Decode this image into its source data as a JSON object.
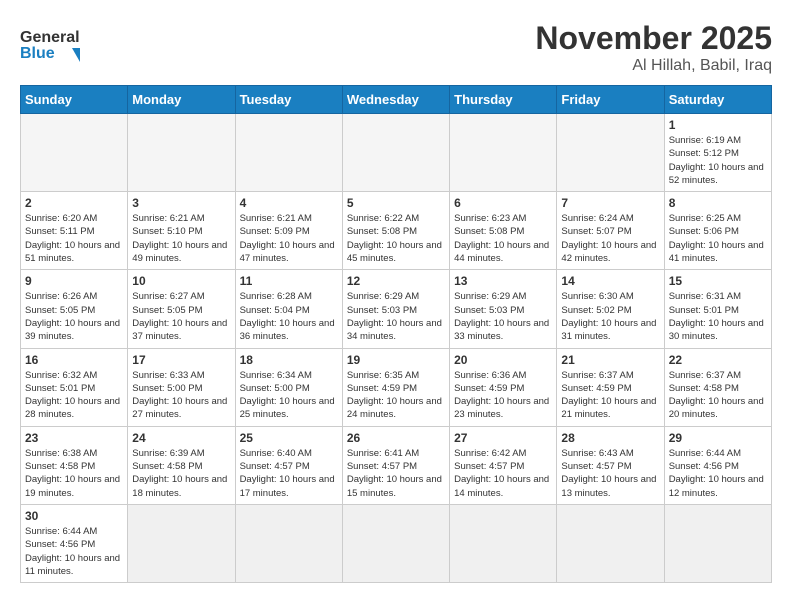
{
  "header": {
    "logo_general": "General",
    "logo_blue": "Blue",
    "month_title": "November 2025",
    "location": "Al Hillah, Babil, Iraq"
  },
  "calendar": {
    "days_of_week": [
      "Sunday",
      "Monday",
      "Tuesday",
      "Wednesday",
      "Thursday",
      "Friday",
      "Saturday"
    ],
    "weeks": [
      [
        {
          "day": "",
          "info": ""
        },
        {
          "day": "",
          "info": ""
        },
        {
          "day": "",
          "info": ""
        },
        {
          "day": "",
          "info": ""
        },
        {
          "day": "",
          "info": ""
        },
        {
          "day": "",
          "info": ""
        },
        {
          "day": "1",
          "info": "Sunrise: 6:19 AM\nSunset: 5:12 PM\nDaylight: 10 hours and 52 minutes."
        }
      ],
      [
        {
          "day": "2",
          "info": "Sunrise: 6:20 AM\nSunset: 5:11 PM\nDaylight: 10 hours and 51 minutes."
        },
        {
          "day": "3",
          "info": "Sunrise: 6:21 AM\nSunset: 5:10 PM\nDaylight: 10 hours and 49 minutes."
        },
        {
          "day": "4",
          "info": "Sunrise: 6:21 AM\nSunset: 5:09 PM\nDaylight: 10 hours and 47 minutes."
        },
        {
          "day": "5",
          "info": "Sunrise: 6:22 AM\nSunset: 5:08 PM\nDaylight: 10 hours and 45 minutes."
        },
        {
          "day": "6",
          "info": "Sunrise: 6:23 AM\nSunset: 5:08 PM\nDaylight: 10 hours and 44 minutes."
        },
        {
          "day": "7",
          "info": "Sunrise: 6:24 AM\nSunset: 5:07 PM\nDaylight: 10 hours and 42 minutes."
        },
        {
          "day": "8",
          "info": "Sunrise: 6:25 AM\nSunset: 5:06 PM\nDaylight: 10 hours and 41 minutes."
        }
      ],
      [
        {
          "day": "9",
          "info": "Sunrise: 6:26 AM\nSunset: 5:05 PM\nDaylight: 10 hours and 39 minutes."
        },
        {
          "day": "10",
          "info": "Sunrise: 6:27 AM\nSunset: 5:05 PM\nDaylight: 10 hours and 37 minutes."
        },
        {
          "day": "11",
          "info": "Sunrise: 6:28 AM\nSunset: 5:04 PM\nDaylight: 10 hours and 36 minutes."
        },
        {
          "day": "12",
          "info": "Sunrise: 6:29 AM\nSunset: 5:03 PM\nDaylight: 10 hours and 34 minutes."
        },
        {
          "day": "13",
          "info": "Sunrise: 6:29 AM\nSunset: 5:03 PM\nDaylight: 10 hours and 33 minutes."
        },
        {
          "day": "14",
          "info": "Sunrise: 6:30 AM\nSunset: 5:02 PM\nDaylight: 10 hours and 31 minutes."
        },
        {
          "day": "15",
          "info": "Sunrise: 6:31 AM\nSunset: 5:01 PM\nDaylight: 10 hours and 30 minutes."
        }
      ],
      [
        {
          "day": "16",
          "info": "Sunrise: 6:32 AM\nSunset: 5:01 PM\nDaylight: 10 hours and 28 minutes."
        },
        {
          "day": "17",
          "info": "Sunrise: 6:33 AM\nSunset: 5:00 PM\nDaylight: 10 hours and 27 minutes."
        },
        {
          "day": "18",
          "info": "Sunrise: 6:34 AM\nSunset: 5:00 PM\nDaylight: 10 hours and 25 minutes."
        },
        {
          "day": "19",
          "info": "Sunrise: 6:35 AM\nSunset: 4:59 PM\nDaylight: 10 hours and 24 minutes."
        },
        {
          "day": "20",
          "info": "Sunrise: 6:36 AM\nSunset: 4:59 PM\nDaylight: 10 hours and 23 minutes."
        },
        {
          "day": "21",
          "info": "Sunrise: 6:37 AM\nSunset: 4:59 PM\nDaylight: 10 hours and 21 minutes."
        },
        {
          "day": "22",
          "info": "Sunrise: 6:37 AM\nSunset: 4:58 PM\nDaylight: 10 hours and 20 minutes."
        }
      ],
      [
        {
          "day": "23",
          "info": "Sunrise: 6:38 AM\nSunset: 4:58 PM\nDaylight: 10 hours and 19 minutes."
        },
        {
          "day": "24",
          "info": "Sunrise: 6:39 AM\nSunset: 4:58 PM\nDaylight: 10 hours and 18 minutes."
        },
        {
          "day": "25",
          "info": "Sunrise: 6:40 AM\nSunset: 4:57 PM\nDaylight: 10 hours and 17 minutes."
        },
        {
          "day": "26",
          "info": "Sunrise: 6:41 AM\nSunset: 4:57 PM\nDaylight: 10 hours and 15 minutes."
        },
        {
          "day": "27",
          "info": "Sunrise: 6:42 AM\nSunset: 4:57 PM\nDaylight: 10 hours and 14 minutes."
        },
        {
          "day": "28",
          "info": "Sunrise: 6:43 AM\nSunset: 4:57 PM\nDaylight: 10 hours and 13 minutes."
        },
        {
          "day": "29",
          "info": "Sunrise: 6:44 AM\nSunset: 4:56 PM\nDaylight: 10 hours and 12 minutes."
        }
      ],
      [
        {
          "day": "30",
          "info": "Sunrise: 6:44 AM\nSunset: 4:56 PM\nDaylight: 10 hours and 11 minutes."
        },
        {
          "day": "",
          "info": ""
        },
        {
          "day": "",
          "info": ""
        },
        {
          "day": "",
          "info": ""
        },
        {
          "day": "",
          "info": ""
        },
        {
          "day": "",
          "info": ""
        },
        {
          "day": "",
          "info": ""
        }
      ]
    ]
  }
}
